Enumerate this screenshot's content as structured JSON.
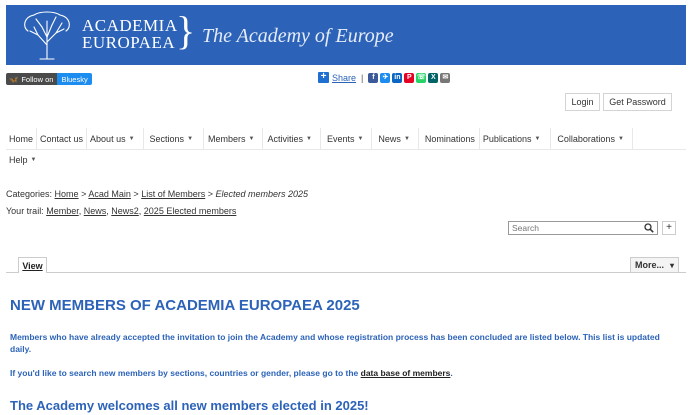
{
  "header": {
    "logo_line1": "ACADEMIA",
    "logo_line2": "EUROPAEA",
    "brace": "}",
    "tagline": "The Academy of Europe",
    "banner_color": "#2c63b8"
  },
  "social": {
    "bluesky_follow": "Follow on",
    "bluesky_name": "Bluesky",
    "share_label": "Share",
    "share_separator": "|",
    "share_icons": [
      {
        "name": "facebook-icon",
        "glyph": "f",
        "color": "#3b5998"
      },
      {
        "name": "bluesky-icon",
        "glyph": "✈",
        "color": "#1d8cf0"
      },
      {
        "name": "linkedin-icon",
        "glyph": "in",
        "color": "#0a66c2"
      },
      {
        "name": "pinterest-icon",
        "glyph": "P",
        "color": "#e60023"
      },
      {
        "name": "whatsapp-icon",
        "glyph": "☏",
        "color": "#25d366"
      },
      {
        "name": "xing-icon",
        "glyph": "X",
        "color": "#026466"
      },
      {
        "name": "email-icon",
        "glyph": "✉",
        "color": "#777777"
      }
    ]
  },
  "auth": {
    "login": "Login",
    "get_password": "Get Password"
  },
  "nav": {
    "home": "Home",
    "contact": "Contact us",
    "about": "About us",
    "sections": "Sections",
    "members": "Members",
    "activities": "Activities",
    "events": "Events",
    "news": "News",
    "nominations": "Nominations",
    "publications": "Publications",
    "collaborations": "Collaborations",
    "help": "Help",
    "caret": "▼"
  },
  "breadcrumb": {
    "prefix": "Categories:",
    "home": "Home",
    "acad_main": "Acad Main",
    "list_members": "List of Members",
    "current": "Elected members 2025",
    "sep": ">"
  },
  "trail": {
    "prefix": "Your trail:",
    "items": [
      "Member",
      "News",
      "News2",
      "2025 Elected members"
    ]
  },
  "search": {
    "placeholder": "Search",
    "add": "+"
  },
  "tabs": {
    "view": "View",
    "more": "More...",
    "more_caret": "▾"
  },
  "content": {
    "title": "NEW MEMBERS OF ACADEMIA EUROPAEA 2025",
    "para1": "Members who have already accepted the invitation to join the Academy and whose registration process has been concluded are listed below. This list is updated daily.",
    "para2_prefix": "If you'd like to search new members by sections, countries or gender, please go to the",
    "para2_link": "data base of members",
    "para2_suffix": ".",
    "welcome": "The Academy welcomes all new members elected in 2025!"
  }
}
